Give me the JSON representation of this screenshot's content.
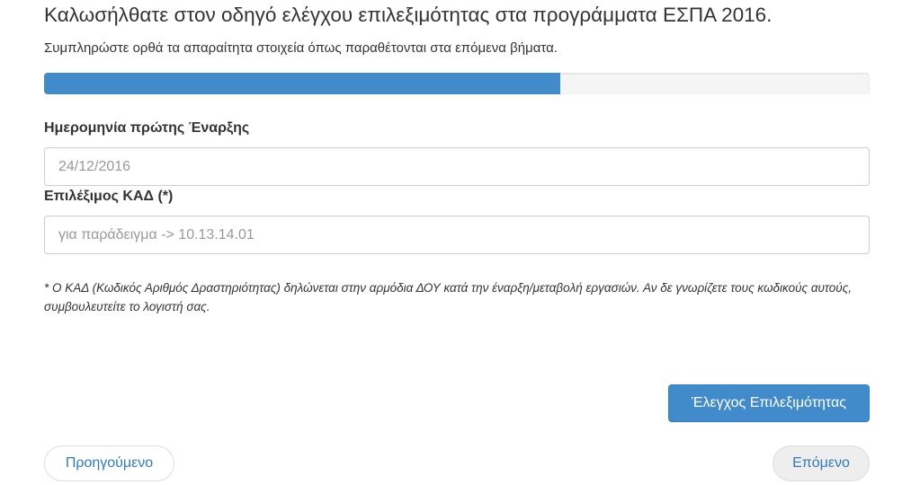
{
  "header": {
    "title": "Καλωσήλθατε στον οδηγό ελέγχου επιλεξιμότητας στα προγράμματα ΕΣΠΑ 2016.",
    "subtitle": "Συμπληρώστε ορθά τα απαραίτητα στοιχεία όπως παραθέτονται στα επόμενα βήματα."
  },
  "progress": {
    "percent": 62.5,
    "color": "#428bca"
  },
  "form": {
    "start_date": {
      "label": "Ημερομηνία πρώτης Έναρξης",
      "placeholder": "24/12/2016"
    },
    "kad": {
      "label": "Επιλέξιμος ΚΑΔ (*)",
      "placeholder": "για παράδειγμα -> 10.13.14.01"
    },
    "note": "* Ο ΚΑΔ (Κωδικός Αριθμός Δραστηριότητας) δηλώνεται στην αρμόδια ΔΟΥ κατά την έναρξη/μεταβολή εργασιών. Αν δε γνωρίζετε τους κωδικούς αυτούς, συμβουλευτείτε το λογιστή σας."
  },
  "buttons": {
    "check": "Έλεγχος Επιλεξιμότητας",
    "previous": "Προηγούμενο",
    "next": "Επόμενο"
  }
}
